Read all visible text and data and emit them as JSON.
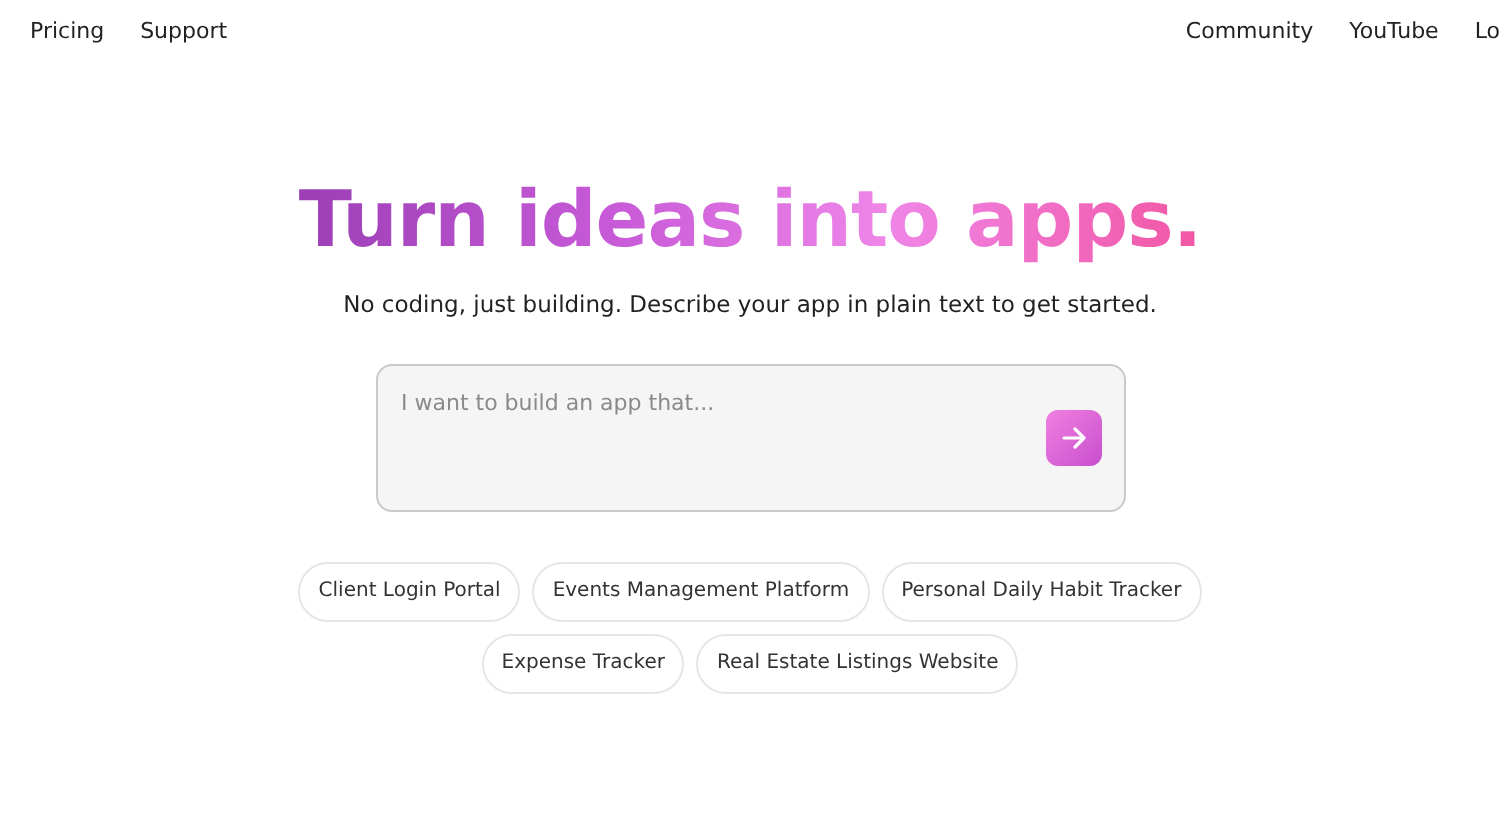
{
  "nav": {
    "left": [
      "Pricing",
      "Support"
    ],
    "right": [
      "Community",
      "YouTube",
      "Lo"
    ]
  },
  "hero": {
    "title": "Turn ideas into apps.",
    "subtitle": "No coding, just building. Describe your app in plain text to get started."
  },
  "prompt": {
    "placeholder": "I want to build an app that..."
  },
  "suggestions": [
    [
      "Client Login Portal",
      "Events Management Platform",
      "Personal Daily Habit Tracker"
    ],
    [
      "Expense Tracker",
      "Real Estate Listings Website"
    ]
  ]
}
